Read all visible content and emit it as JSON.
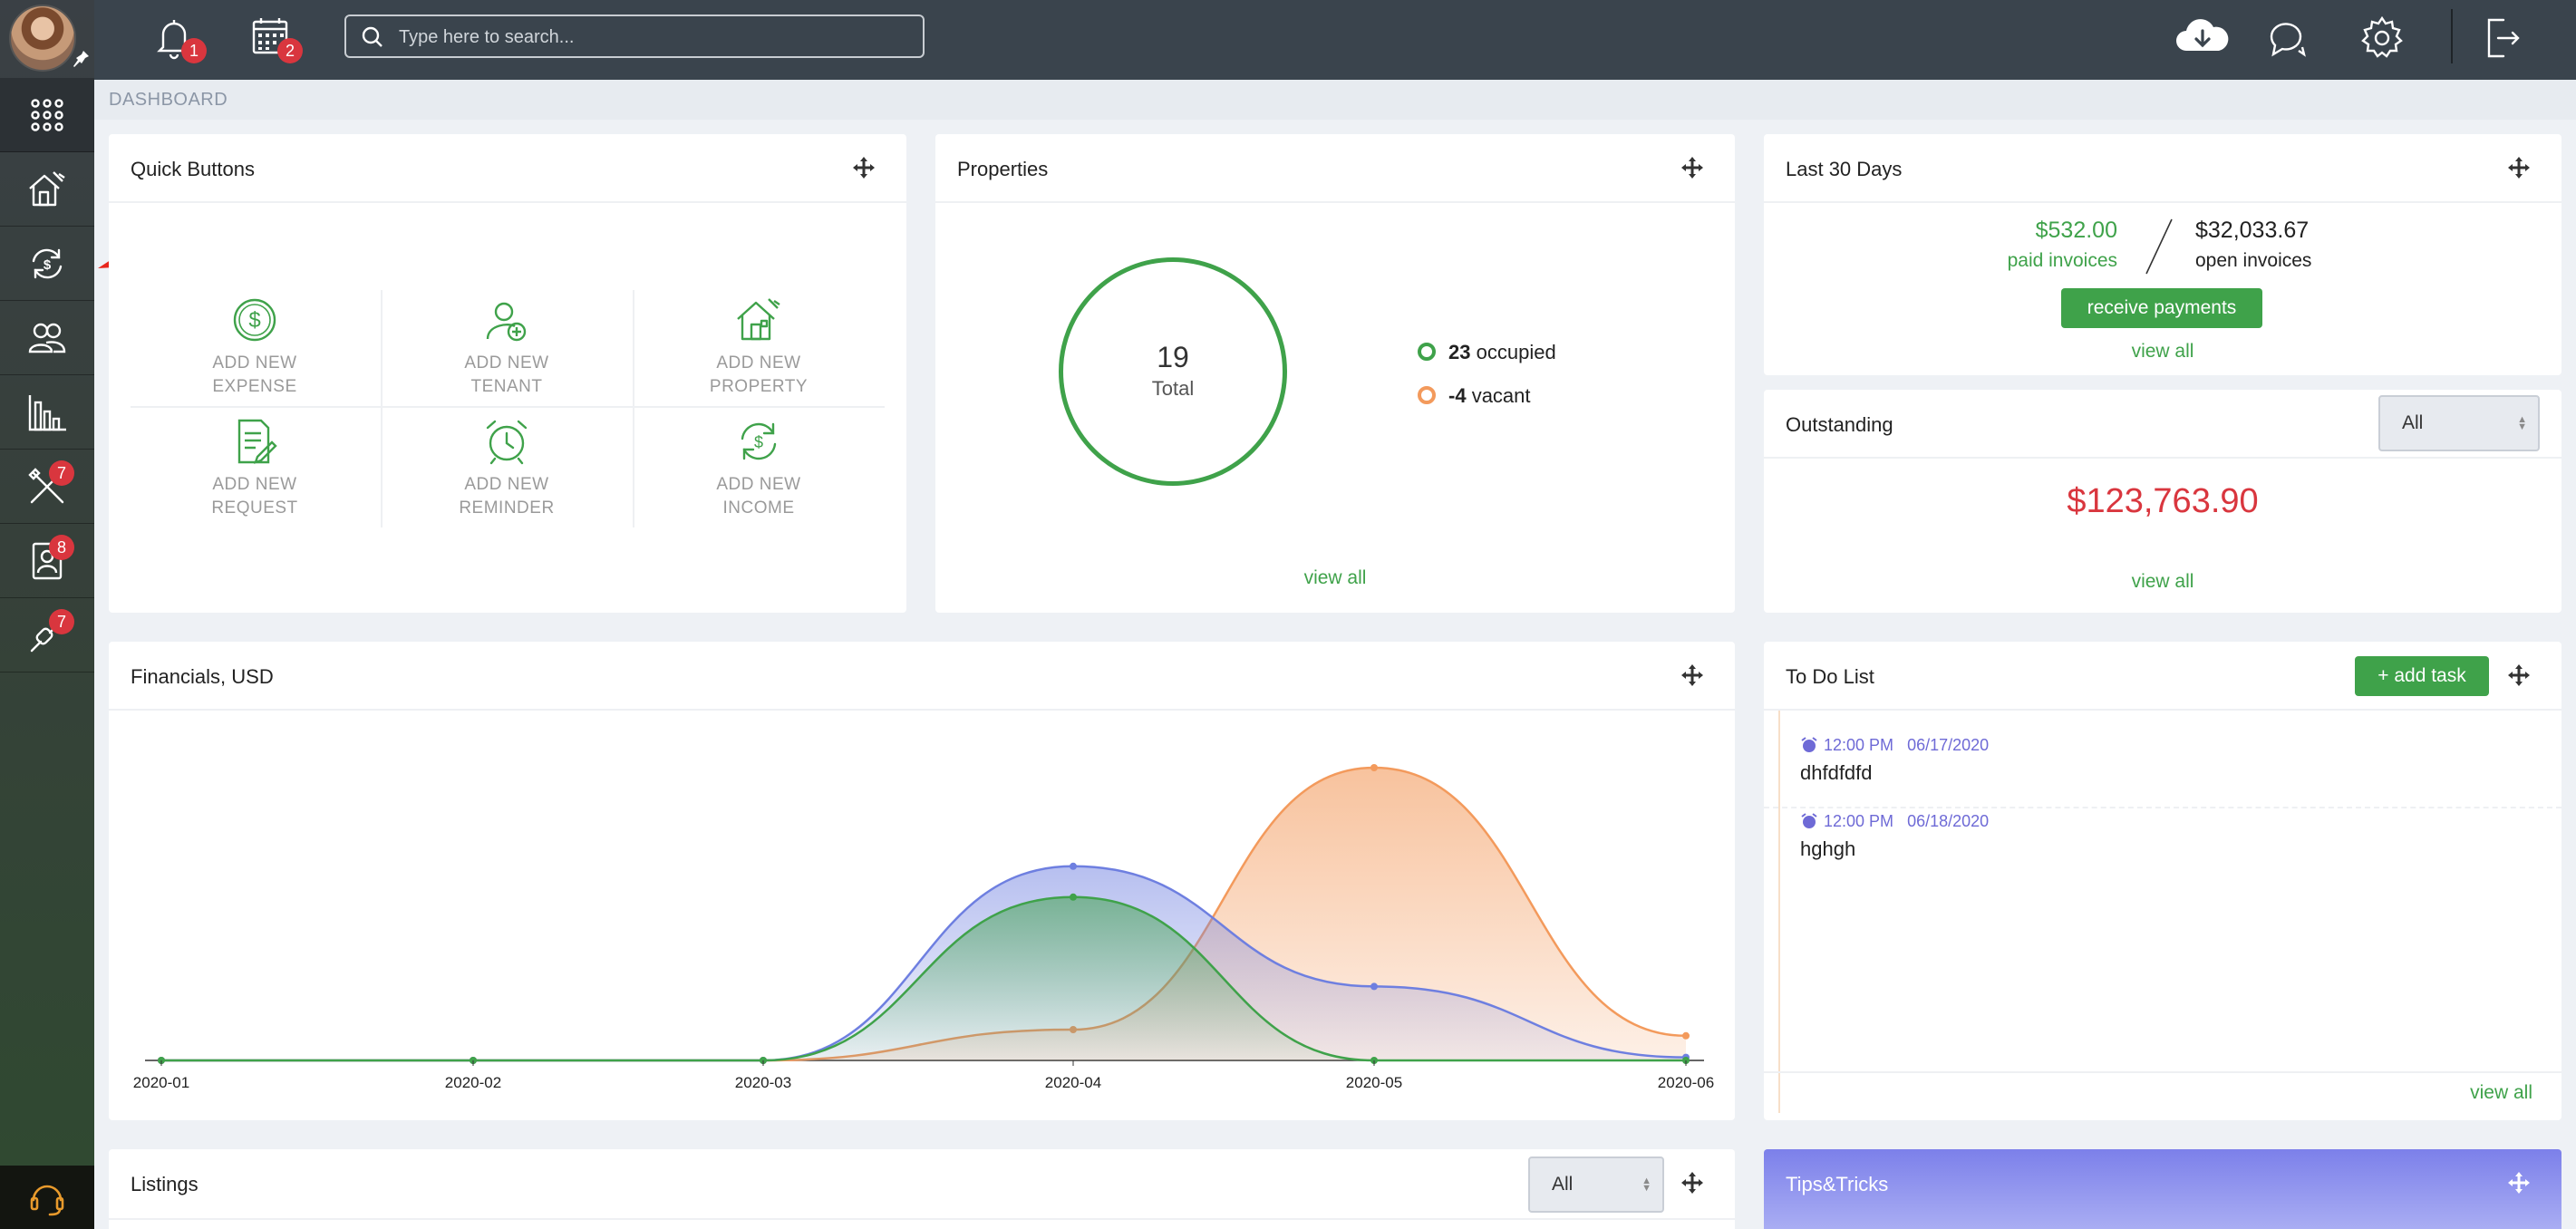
{
  "topbar": {
    "notifications_badge": "1",
    "calendar_badge": "2",
    "search_placeholder": "Type here to search..."
  },
  "sidebar": {
    "badges": {
      "maintenance": "7",
      "tenants": "8",
      "integrations": "7"
    }
  },
  "breadcrumb": "DASHBOARD",
  "quick_buttons": {
    "title": "Quick Buttons",
    "items": [
      {
        "line1": "ADD NEW",
        "line2": "EXPENSE"
      },
      {
        "line1": "ADD NEW",
        "line2": "TENANT"
      },
      {
        "line1": "ADD NEW",
        "line2": "PROPERTY"
      },
      {
        "line1": "ADD NEW",
        "line2": "REQUEST"
      },
      {
        "line1": "ADD NEW",
        "line2": "REMINDER"
      },
      {
        "line1": "ADD NEW",
        "line2": "INCOME"
      }
    ]
  },
  "properties": {
    "title": "Properties",
    "total_value": "19",
    "total_label": "Total",
    "occupied_value": "23",
    "occupied_label": "occupied",
    "vacant_value": "-4",
    "vacant_label": "vacant",
    "view_all": "view all"
  },
  "last30": {
    "title": "Last 30 Days",
    "paid_amount": "$532.00",
    "paid_label": "paid invoices",
    "open_amount": "$32,033.67",
    "open_label": "open invoices",
    "button": "receive payments",
    "view_all": "view all"
  },
  "outstanding": {
    "title": "Outstanding",
    "select_value": "All",
    "amount": "$123,763.90",
    "view_all": "view all"
  },
  "financials": {
    "title": "Financials, USD"
  },
  "todo": {
    "title": "To Do List",
    "add_button": "+ add task",
    "items": [
      {
        "time": "12:00 PM",
        "date": "06/17/2020",
        "text": "dhfdfdfd"
      },
      {
        "time": "12:00 PM",
        "date": "06/18/2020",
        "text": "hghgh"
      }
    ],
    "view_all": "view all"
  },
  "listings": {
    "title": "Listings",
    "select_value": "All"
  },
  "tips": {
    "title": "Tips&Tricks"
  },
  "colors": {
    "green": "#3fa24a",
    "red": "#d9363e",
    "blue_series": "#6e7fe0",
    "green_series": "#3fa24a",
    "orange_series": "#f39a5c"
  },
  "chart_data": {
    "type": "area",
    "categories": [
      "2020-01",
      "2020-02",
      "2020-03",
      "2020-04",
      "2020-05",
      "2020-06"
    ],
    "series": [
      {
        "values": [
          0,
          0,
          0,
          63,
          24,
          1
        ],
        "color": "#6e7fe0"
      },
      {
        "values": [
          0,
          0,
          0,
          53,
          0,
          0
        ],
        "color": "#3fa24a"
      },
      {
        "values": [
          0,
          0,
          0,
          10,
          95,
          8
        ],
        "color": "#f39a5c"
      }
    ],
    "ylim": [
      0,
      100
    ],
    "grid": false
  }
}
